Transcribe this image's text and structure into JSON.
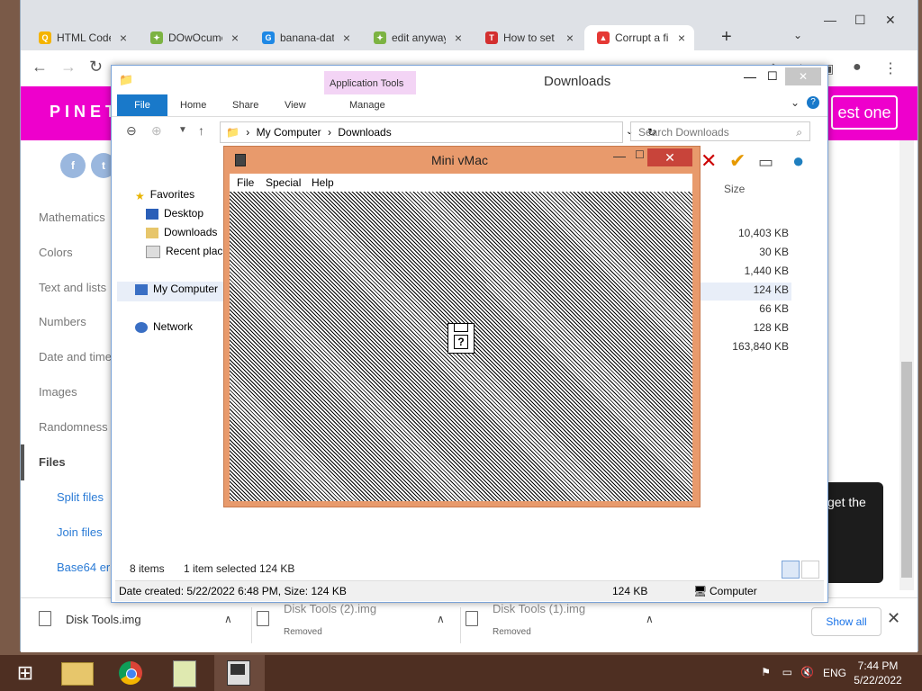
{
  "chrome": {
    "tabs": [
      {
        "label": "HTML Code",
        "icon": "search-icon",
        "color": "#f4b400"
      },
      {
        "label": "DOwOcume",
        "icon": "puzzle-icon",
        "color": "#7cb342"
      },
      {
        "label": "banana-dat",
        "icon": "gif-icon",
        "color": "#1e88e5"
      },
      {
        "label": "edit anyway",
        "icon": "puzzle-icon",
        "color": "#7cb342"
      },
      {
        "label": "How to set",
        "icon": "ta-icon",
        "color": "#d32f2f"
      },
      {
        "label": "Corrupt a fi",
        "icon": "tree-icon",
        "color": "#e53935"
      }
    ],
    "new_tab": "+",
    "tab_search": "⌄"
  },
  "site": {
    "logo": "PINET",
    "cta": "est one",
    "side_links": [
      "Mathematics",
      "Colors",
      "Text and lists",
      "Numbers",
      "Date and time",
      "Images",
      "Randomness",
      "Files"
    ],
    "side_sublinks": [
      "Split files",
      "Join files",
      "Base64 er"
    ],
    "card_text": "get the"
  },
  "explorer": {
    "title": "Downloads",
    "app_tools": "Application Tools",
    "ribbon_tabs": [
      "File",
      "Home",
      "Share",
      "View",
      "Manage"
    ],
    "address": [
      "My Computer",
      "Downloads"
    ],
    "search_placeholder": "Search Downloads",
    "nav": {
      "favorites": "Favorites",
      "desktop": "Desktop",
      "downloads": "Downloads",
      "recent": "Recent place",
      "computer": "My Computer",
      "network": "Network"
    },
    "size_header": "Size",
    "sizes": [
      "10,403 KB",
      "30 KB",
      "1,440 KB",
      "124 KB",
      "66 KB",
      "128 KB",
      "163,840 KB"
    ],
    "status_items": "8 items",
    "status_selected": "1 item selected  124 KB",
    "details": "Date created: 5/22/2022 6:48 PM, Size: 124 KB",
    "details_size": "124 KB",
    "details_location": "Computer"
  },
  "vmac": {
    "title": "Mini vMac",
    "menu": [
      "File",
      "Special",
      "Help"
    ],
    "disk_symbol": "?"
  },
  "downloads_bar": {
    "items": [
      {
        "name": "Disk Tools.img",
        "status": ""
      },
      {
        "name": "Disk Tools (2).img",
        "status": "Removed"
      },
      {
        "name": "Disk Tools (1).img",
        "status": "Removed"
      }
    ],
    "show_all": "Show all"
  },
  "taskbar": {
    "lang": "ENG",
    "time": "7:44 PM",
    "date": "5/22/2022"
  }
}
